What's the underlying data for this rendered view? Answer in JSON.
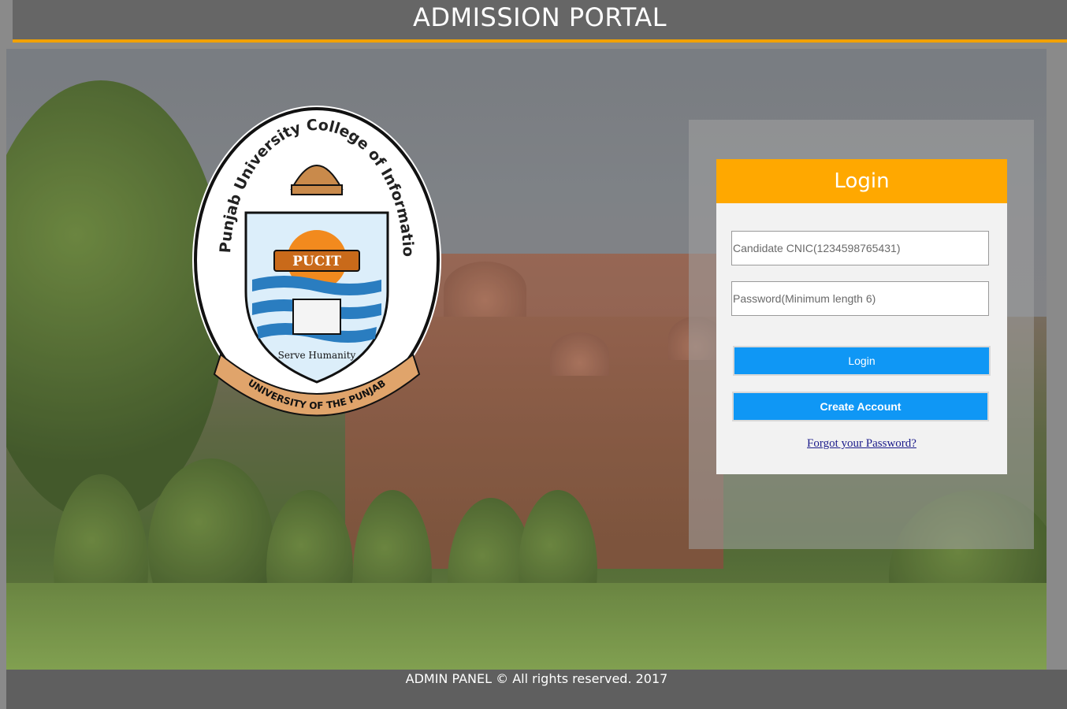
{
  "header": {
    "title": "ADMISSION PORTAL"
  },
  "logo": {
    "ring_text": "Punjab University College of Information Technology",
    "crest_text": "PUCIT",
    "motto": "Serve Humanity",
    "ribbon_text": "UNIVERSITY OF THE PUNJAB"
  },
  "login": {
    "title": "Login",
    "cnic_placeholder": "Candidate CNIC(1234598765431)",
    "password_placeholder": "Password(Minimum length 6)",
    "login_button": "Login",
    "create_account_button": "Create Account",
    "forgot_link": "Forgot your Password?"
  },
  "footer": {
    "text": "ADMIN PANEL © All rights reserved. 2017"
  },
  "colors": {
    "header_bg": "#666666",
    "accent": "#ffa800",
    "button": "#0f97f5",
    "footer_bg": "#5f5f5f"
  }
}
